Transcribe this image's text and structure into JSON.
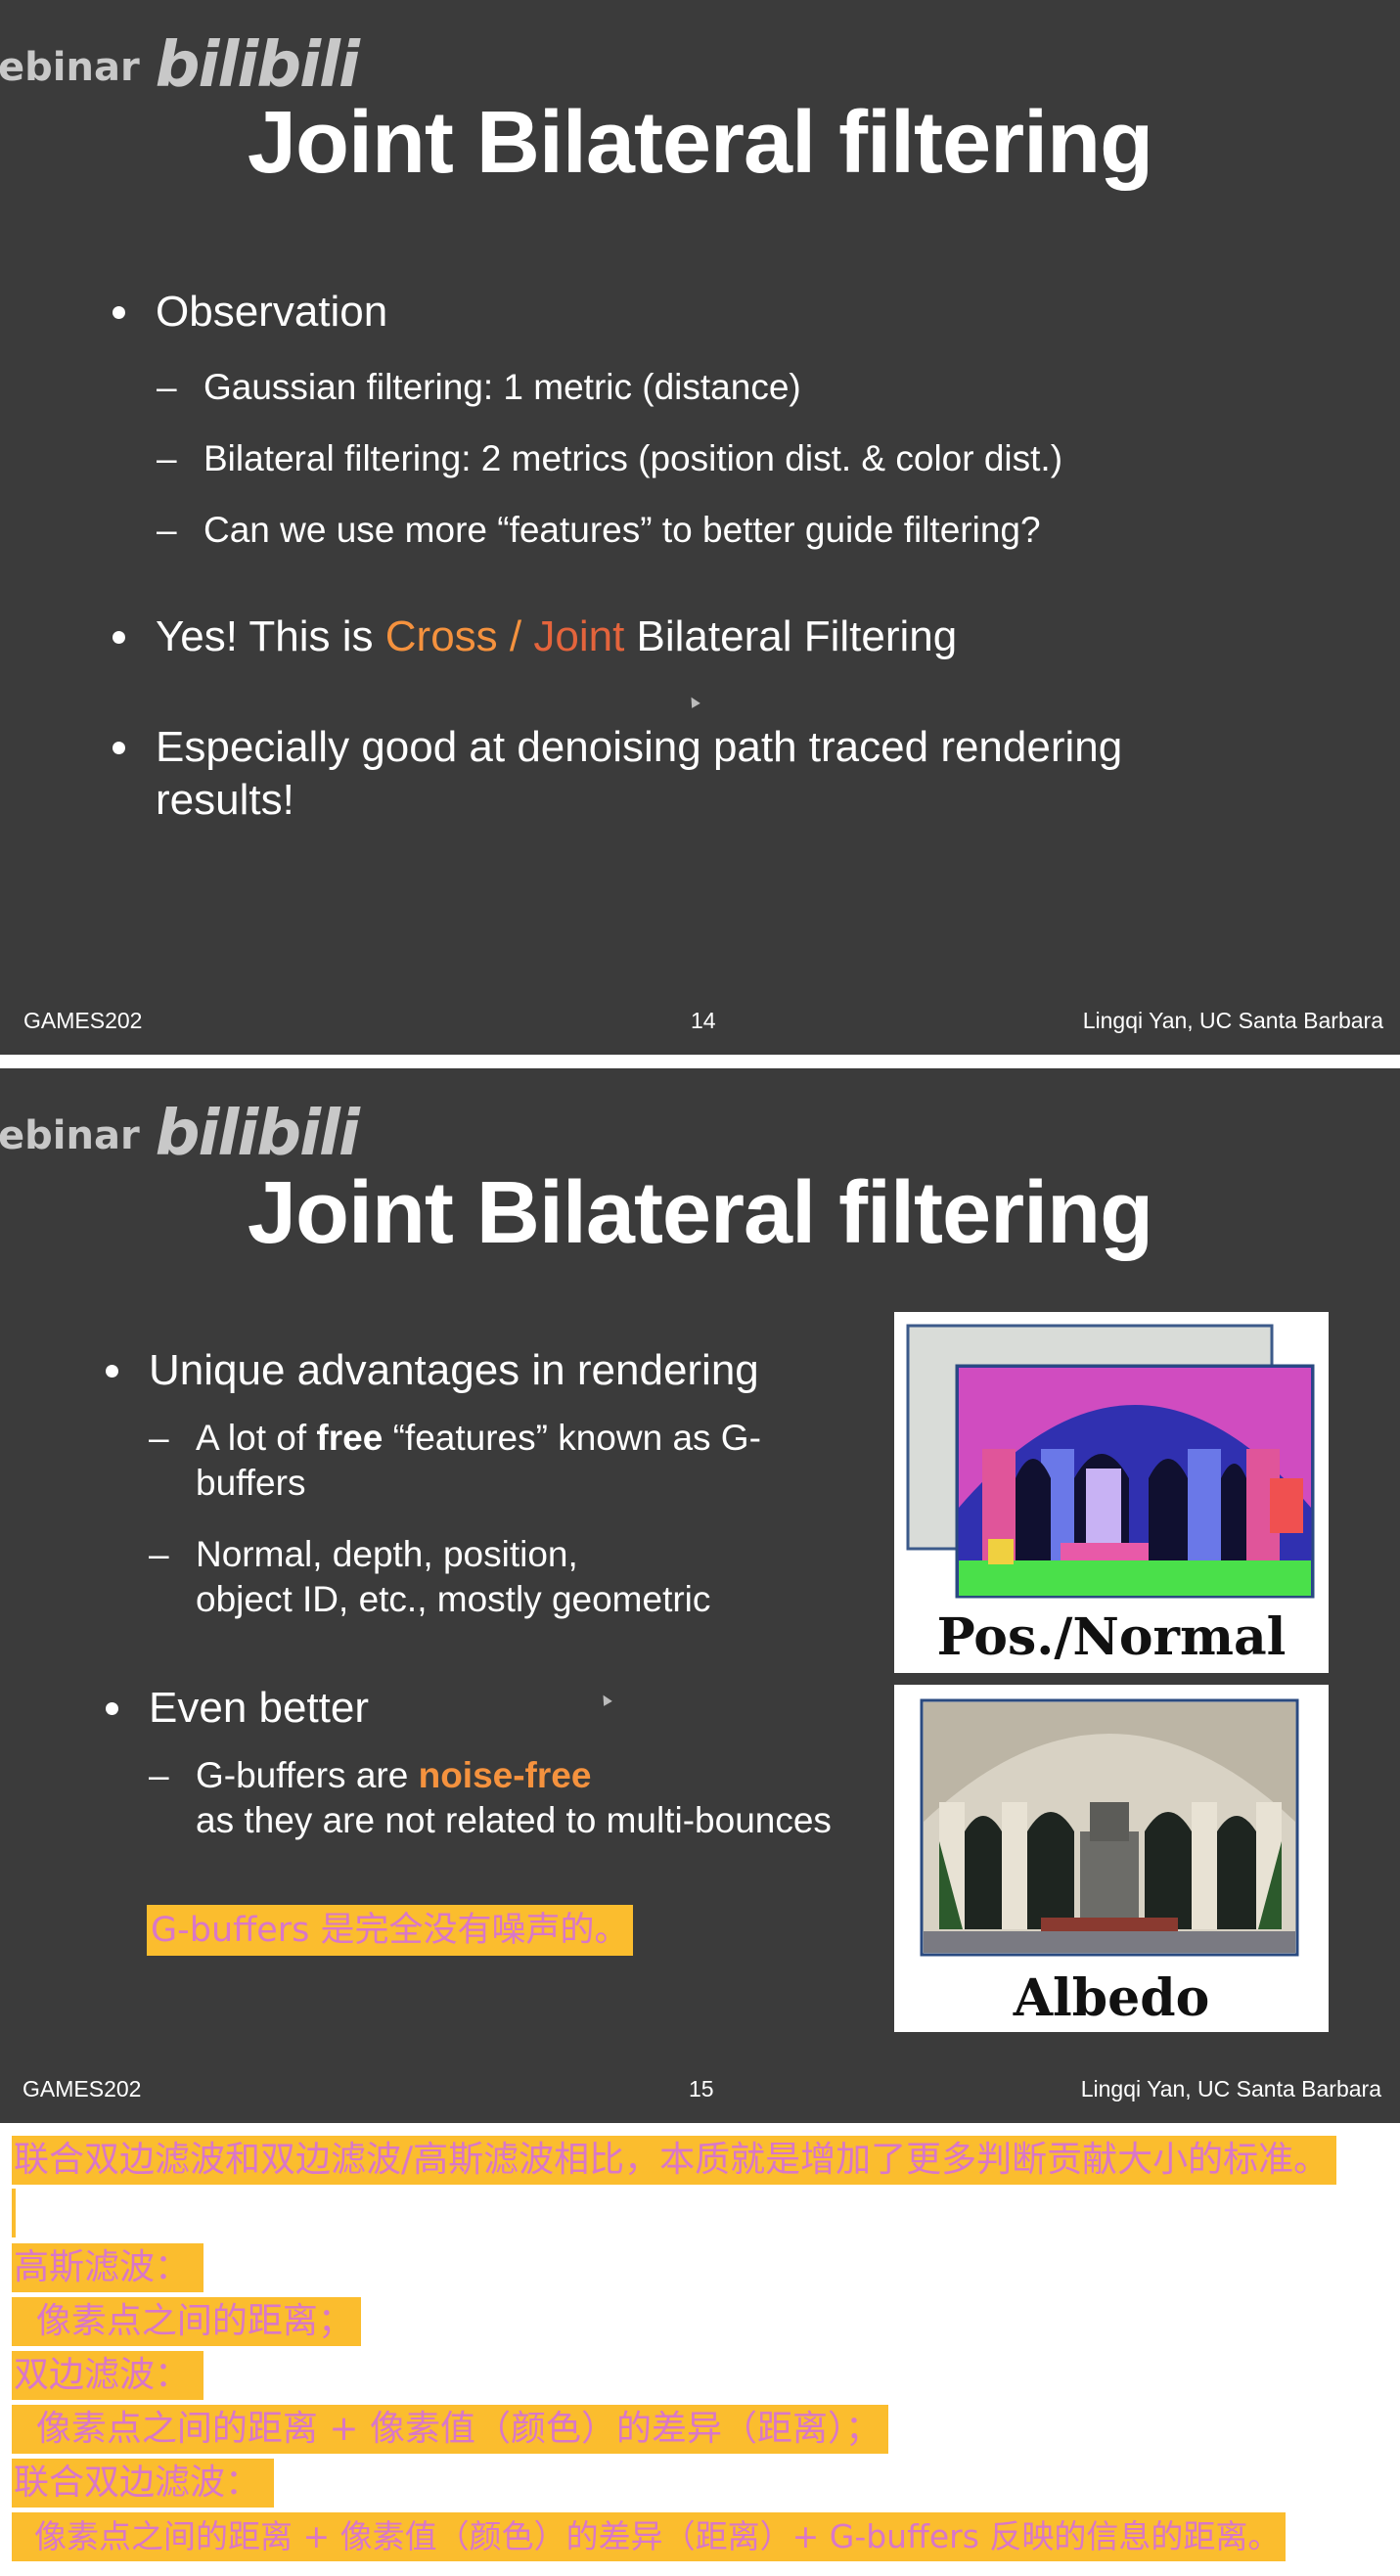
{
  "watermark": {
    "text": "ebinar",
    "logo": "bilibili"
  },
  "slide1": {
    "title": "Joint Bilateral filtering",
    "bullet1": "Observation",
    "subs": [
      "Gaussian filtering: 1 metric (distance)",
      "Bilateral filtering: 2 metrics (position dist. & color dist.)",
      "Can we use more “features” to better guide filtering?"
    ],
    "bullet2_pre": "Yes! This is ",
    "bullet2_cross": "Cross / ",
    "bullet2_joint": "Joint",
    "bullet2_post": " Bilateral Filtering",
    "bullet3_line1": "Especially good at denoising path traced rendering",
    "bullet3_line2": "results!",
    "footer_left": "GAMES202",
    "footer_page": "14",
    "footer_right": "Lingqi Yan, UC Santa Barbara"
  },
  "slide2": {
    "title": "Joint Bilateral filtering",
    "bullet1": "Unique advantages in rendering",
    "sub1_pre": "A lot of ",
    "sub1_bold": "free",
    "sub1_post": " “features” known as G-",
    "sub1_line2": "buffers",
    "sub2_line1": "Normal, depth, position,",
    "sub2_line2": "object ID, etc., mostly geometric",
    "bullet2": "Even better",
    "sub3_pre": "G-buffers are ",
    "sub3_orange": "noise-free",
    "sub3_line2": "as they are not related to multi-bounces",
    "annotation": "G-buffers 是完全没有噪声的。",
    "image1_caption": "Pos./Normal",
    "image2_caption": "Albedo",
    "footer_left": "GAMES202",
    "footer_page": "15",
    "footer_right": "Lingqi Yan, UC Santa Barbara"
  },
  "notes": [
    "联合双边滤波和双边滤波/高斯滤波相比，本质就是增加了更多判断贡献大小的标准。",
    "",
    "高斯滤波：",
    "  像素点之间的距离；",
    "双边滤波：",
    "  像素点之间的距离 + 像素值（颜色）的差异（距离）；",
    "联合双边滤波：",
    "  像素点之间的距离 + 像素值（颜色）的差异（距离）+ G-buffers 反映的信息的距离。"
  ],
  "colors": {
    "slide_bg": "#3b3b3b",
    "orange": "#f5923e",
    "red": "#e4643c",
    "highlight_bg": "#fbbd2e",
    "highlight_text": "#d977c8"
  }
}
